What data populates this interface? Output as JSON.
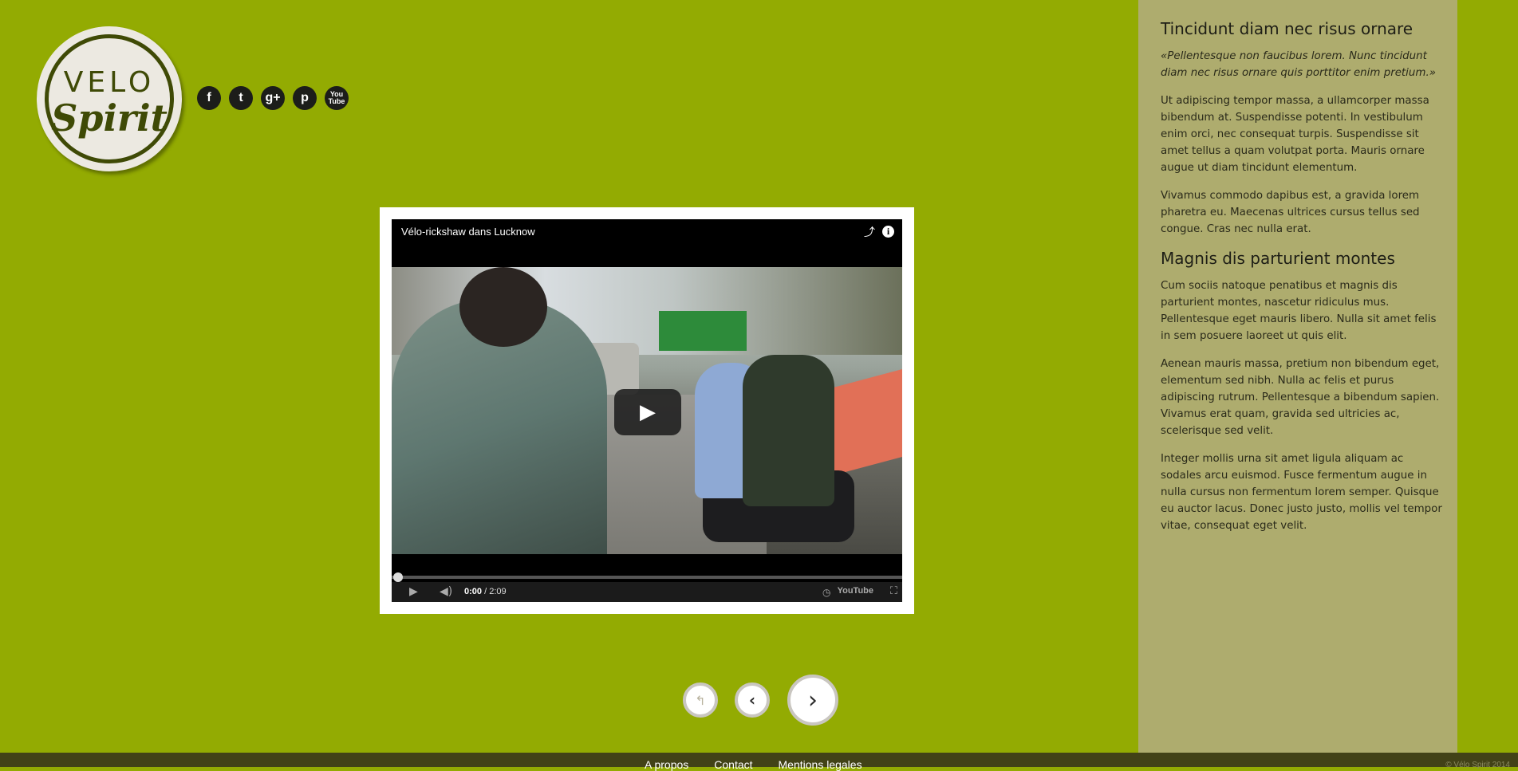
{
  "brand": {
    "logo_top": "VELO",
    "logo_bottom": "Spirit"
  },
  "social": [
    {
      "label": "f",
      "icon": "facebook-icon"
    },
    {
      "label": "t",
      "icon": "twitter-icon"
    },
    {
      "label": "g+",
      "icon": "google-plus-icon"
    },
    {
      "label": "p",
      "icon": "pinterest-icon"
    },
    {
      "label": "You Tube",
      "icon": "youtube-icon"
    }
  ],
  "video": {
    "title": "Vélo-rickshaw dans Lucknow",
    "current_time": "0:00",
    "duration": " / 2:09",
    "progress": 0,
    "yt_label": "YouTube"
  },
  "nav": {
    "home_glyph": "↰",
    "prev_glyph": "‹",
    "next_glyph": "›"
  },
  "sidebar": {
    "heading1": "Tincidunt diam nec risus ornare",
    "quote": "«Pellentesque non faucibus lorem. Nunc tincidunt diam nec risus ornare quis porttitor enim pretium.»",
    "p1": "Ut adipiscing tempor massa, a ullamcorper massa bibendum at. Suspendisse potenti. In vestibulum enim orci, nec consequat turpis. Suspendisse sit amet tellus a quam volutpat porta. Mauris ornare augue ut diam tincidunt elementum.",
    "p2": "Vivamus commodo dapibus est, a gravida lorem pharetra eu. Maecenas ultrices cursus tellus sed congue. Cras nec nulla erat.",
    "heading2": "Magnis dis parturient montes",
    "p3": "Cum sociis natoque penatibus et magnis dis parturient montes, nascetur ridiculus mus. Pellentesque eget mauris libero. Nulla sit amet felis in sem posuere laoreet ut quis elit.",
    "p4": "Aenean mauris massa, pretium non bibendum eget, elementum sed nibh. Nulla ac felis et purus adipiscing rutrum. Pellentesque a bibendum sapien. Vivamus erat quam, gravida sed ultricies ac, scelerisque sed velit.",
    "p5": "Integer mollis urna sit amet ligula aliquam ac sodales arcu euismod. Fusce fermentum augue in nulla cursus non fermentum lorem semper. Quisque eu auctor lacus. Donec justo justo, mollis vel tempor vitae, consequat eget velit."
  },
  "footer": {
    "links": [
      "A propos",
      "Contact",
      "Mentions legales"
    ],
    "copyright": "© Vélo Spirit 2014"
  },
  "colors": {
    "background": "#93ab02",
    "sidebar": "#aeac6e",
    "footer": "#424217"
  }
}
